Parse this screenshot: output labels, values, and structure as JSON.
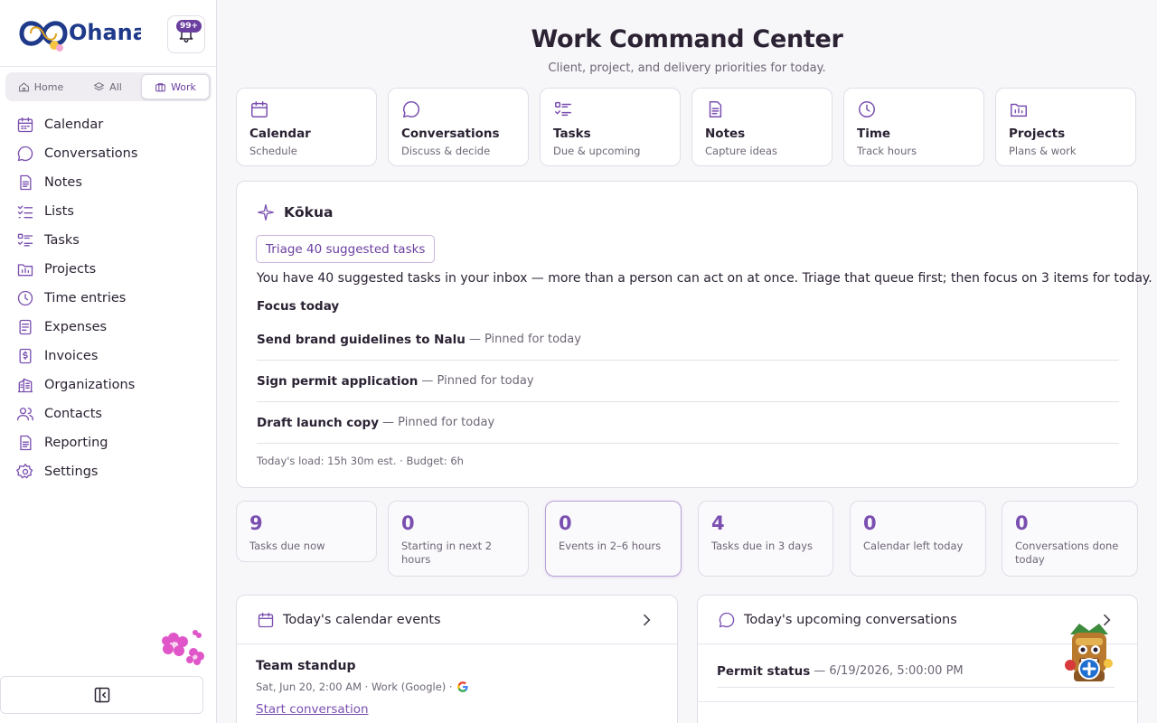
{
  "app": {
    "logo_text": "Ohana",
    "notification_badge": "99+"
  },
  "workspace_switch": [
    {
      "label": "Home",
      "icon": "home-icon",
      "active": false
    },
    {
      "label": "All",
      "icon": "layers-icon",
      "active": false
    },
    {
      "label": "Work",
      "icon": "briefcase-icon",
      "active": true
    }
  ],
  "sidebar": {
    "items": [
      {
        "label": "Calendar",
        "icon": "calendar-icon"
      },
      {
        "label": "Conversations",
        "icon": "chat-icon"
      },
      {
        "label": "Notes",
        "icon": "document-icon"
      },
      {
        "label": "Lists",
        "icon": "checklist-icon"
      },
      {
        "label": "Tasks",
        "icon": "tasks-icon"
      },
      {
        "label": "Projects",
        "icon": "folder-icon"
      },
      {
        "label": "Time entries",
        "icon": "clock-icon"
      },
      {
        "label": "Expenses",
        "icon": "receipt-icon"
      },
      {
        "label": "Invoices",
        "icon": "dollar-doc-icon"
      },
      {
        "label": "Organizations",
        "icon": "building-icon"
      },
      {
        "label": "Contacts",
        "icon": "people-icon"
      },
      {
        "label": "Reporting",
        "icon": "report-icon"
      },
      {
        "label": "Settings",
        "icon": "gear-icon"
      }
    ]
  },
  "header": {
    "title": "Work Command Center",
    "subtitle": "Client, project, and delivery priorities for today."
  },
  "shortcuts": [
    {
      "title": "Calendar",
      "subtitle": "Schedule",
      "icon": "calendar-icon"
    },
    {
      "title": "Conversations",
      "subtitle": "Discuss & decide",
      "icon": "chat-icon"
    },
    {
      "title": "Tasks",
      "subtitle": "Due & upcoming",
      "icon": "tasks-icon"
    },
    {
      "title": "Notes",
      "subtitle": "Capture ideas",
      "icon": "document-icon"
    },
    {
      "title": "Time",
      "subtitle": "Track hours",
      "icon": "clock-icon"
    },
    {
      "title": "Projects",
      "subtitle": "Plans & work",
      "icon": "folder-icon"
    }
  ],
  "kokua": {
    "title": "Kōkua",
    "triage_button": "Triage 40 suggested tasks",
    "message": "You have 40 suggested tasks in your inbox — more than a person can act on at once. Triage that queue first; then focus on 3 items for today.",
    "focus_heading": "Focus today",
    "focus_items": [
      {
        "name": "Send brand guidelines to Nalu",
        "note": "— Pinned for today"
      },
      {
        "name": "Sign permit application",
        "note": "— Pinned for today"
      },
      {
        "name": "Draft launch copy",
        "note": "— Pinned for today"
      }
    ],
    "load": "Today's load: 15h 30m est. · Budget: 6h"
  },
  "stats": [
    {
      "value": "9",
      "label": "Tasks due now",
      "active": false
    },
    {
      "value": "0",
      "label": "Starting in next 2 hours",
      "active": false
    },
    {
      "value": "0",
      "label": "Events in 2–6 hours",
      "active": true
    },
    {
      "value": "4",
      "label": "Tasks due in 3 days",
      "active": false
    },
    {
      "value": "0",
      "label": "Calendar left today",
      "active": false
    },
    {
      "value": "0",
      "label": "Conversations done today",
      "active": false
    }
  ],
  "calendar_panel": {
    "title": "Today's calendar events",
    "event": {
      "title": "Team standup",
      "meta": "Sat, Jun 20, 2:00 AM · Work (Google) ·",
      "action": "Start conversation"
    }
  },
  "conversations_panel": {
    "title": "Today's upcoming conversations",
    "item": {
      "name": "Permit status",
      "date": "— 6/19/2026, 5:00:00 PM"
    }
  },
  "colors": {
    "accent": "#7a4fb0",
    "badge": "#6b3fa0",
    "border": "#e1dde8",
    "background": "#f7f6f9"
  }
}
